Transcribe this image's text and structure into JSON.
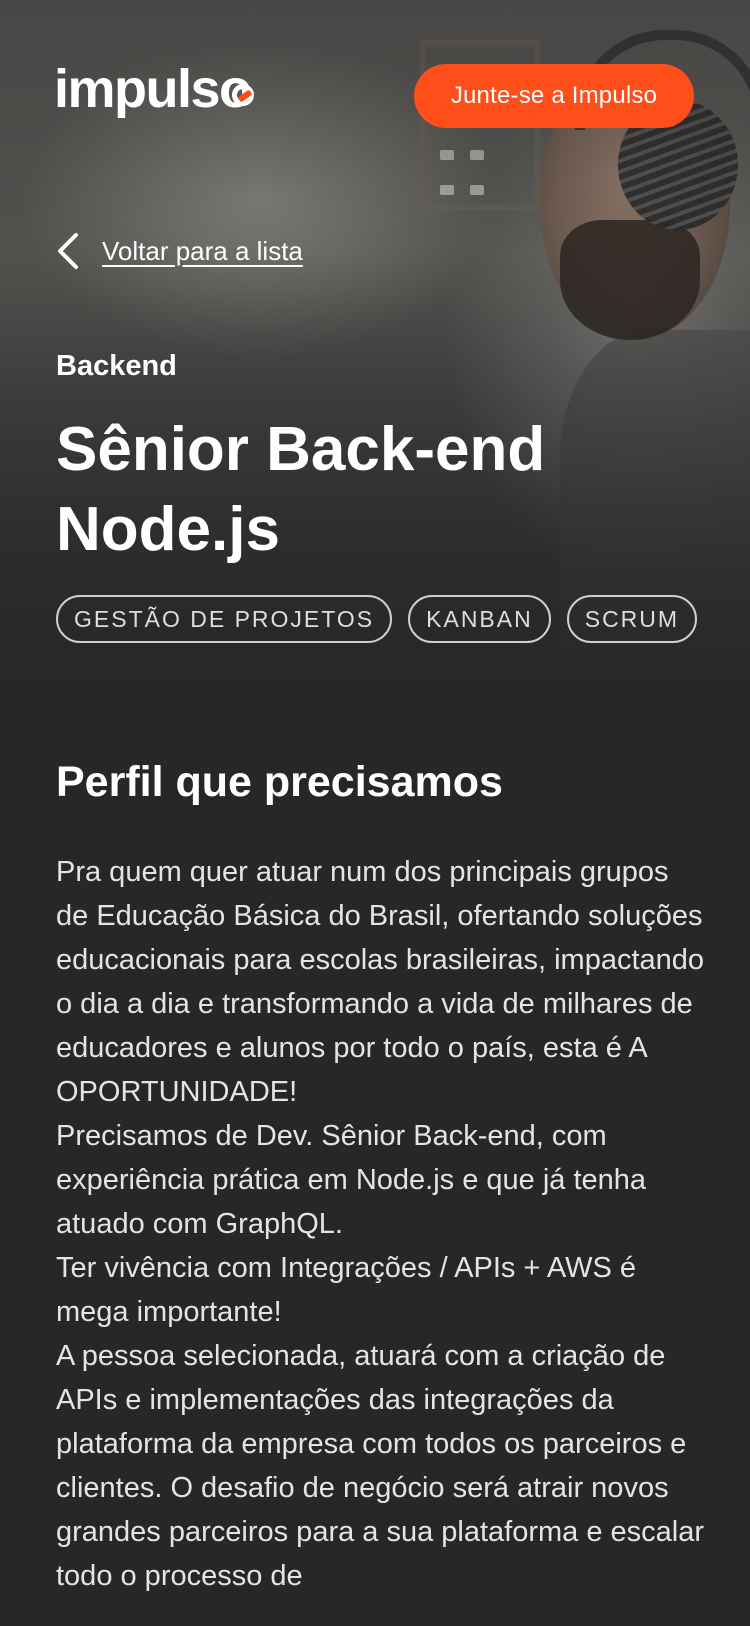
{
  "header": {
    "logo_text": "impulso",
    "join_button": "Junte-se a Impulso",
    "brand_color": "#ff4e1a"
  },
  "back_link": {
    "label": "Voltar para a lista",
    "icon": "chevron-left-icon"
  },
  "job": {
    "category": "Backend",
    "title": "Sênior Back-end Node.js",
    "tags": [
      "GESTÃO DE PROJETOS",
      "KANBAN",
      "SCRUM"
    ]
  },
  "profile": {
    "heading": "Perfil que precisamos",
    "paragraphs": [
      "Pra quem quer atuar num dos principais grupos de Educação Básica do Brasil, ofertando soluções educacionais para escolas brasileiras, impactando o dia a dia e transformando a vida de milhares de educadores e alunos por todo o país, esta é A OPORTUNIDADE!",
      "Precisamos de Dev. Sênior Back-end, com experiência prática em Node.js e que já tenha atuado com GraphQL.",
      "Ter vivência com Integrações / APIs + AWS é mega importante!",
      "A pessoa selecionada, atuará com a criação de APIs e implementações das integrações da plataforma da empresa com todos os parceiros e clientes. O desafio de negócio será atrair novos grandes parceiros para a sua plataforma e escalar todo o processo de"
    ]
  },
  "colors": {
    "background": "#262729",
    "text": "#ffffff",
    "body_text": "#e4e4e4",
    "tag_border": "#cfcfcf"
  }
}
